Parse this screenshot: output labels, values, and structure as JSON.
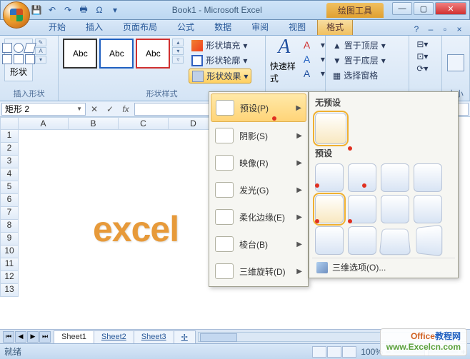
{
  "title": "Book1 - Microsoft Excel",
  "drawing_tools": "绘图工具",
  "tabs": [
    "开始",
    "插入",
    "页面布局",
    "公式",
    "数据",
    "审阅",
    "视图",
    "格式"
  ],
  "active_tab": 7,
  "groups": {
    "insert_shapes": "插入形状",
    "shape_styles": "形状样式",
    "shapes_label": "形状",
    "abc": "Abc",
    "fill": "形状填充",
    "outline": "形状轮廓",
    "effects": "形状效果",
    "quick_style": "快速样式",
    "arrange": {
      "front": "置于顶层",
      "back": "置于底层",
      "select": "选择窗格"
    },
    "size": "大小"
  },
  "name_box": "矩形 2",
  "fx": "fx",
  "columns": [
    "A",
    "B",
    "C",
    "D"
  ],
  "rows": [
    "1",
    "2",
    "3",
    "4",
    "5",
    "6",
    "7",
    "8",
    "9",
    "10",
    "11",
    "12",
    "13"
  ],
  "watermark": "excel",
  "dropdown": {
    "preset": "预设(P)",
    "shadow": "阴影(S)",
    "reflect": "映像(R)",
    "glow": "发光(G)",
    "soft": "柔化边缘(E)",
    "bevel": "棱台(B)",
    "rot3d": "三维旋转(D)"
  },
  "preset_panel": {
    "none": "无预设",
    "presets": "预设",
    "more": "三维选项(O)..."
  },
  "sheets": [
    "Sheet1",
    "Sheet2",
    "Sheet3"
  ],
  "status": "就绪",
  "zoom": "100%",
  "logo": {
    "l1a": "Office",
    "l1b": "教程网",
    "l2": "www.Excelcn.com"
  }
}
